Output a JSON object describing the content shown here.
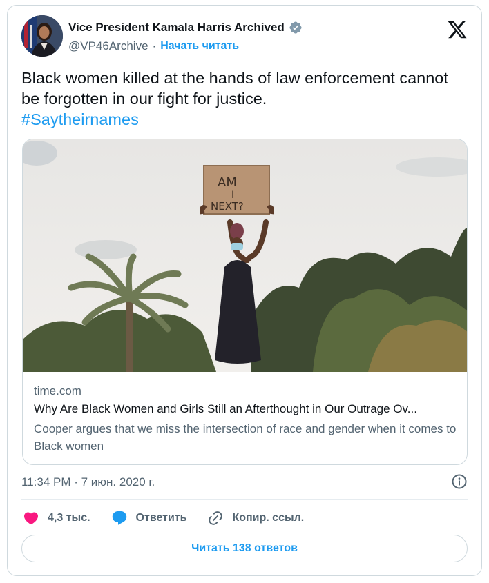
{
  "author": {
    "display_name": "Vice President Kamala Harris Archived",
    "handle": "@VP46Archive",
    "separator": "·",
    "follow_label": "Начать читать",
    "verified_icon": "verified-badge-icon",
    "verified_color": "#829aab"
  },
  "tweet": {
    "text": "Black women killed at the hands of law enforcement cannot be forgotten in our fight for justice.",
    "hashtag": "#Saytheirnames"
  },
  "link_card": {
    "image_alt_sign_text": "AM I NEXT?",
    "domain": "time.com",
    "title": "Why Are Black Women and Girls Still an Afterthought in Our Outrage Ov...",
    "description": "Cooper argues that we miss the intersection of race and gender when it comes to Black women"
  },
  "timestamp": "11:34 PM · 7 июн. 2020 г.",
  "actions": {
    "likes_label": "4,3 тыс.",
    "reply_label": "Ответить",
    "copy_link_label": "Копир. ссыл."
  },
  "read_replies_label": "Читать 138 ответов",
  "colors": {
    "accent": "#1d9bf0",
    "like": "#f91880",
    "text_secondary": "#536471",
    "border": "#cfd9de"
  }
}
